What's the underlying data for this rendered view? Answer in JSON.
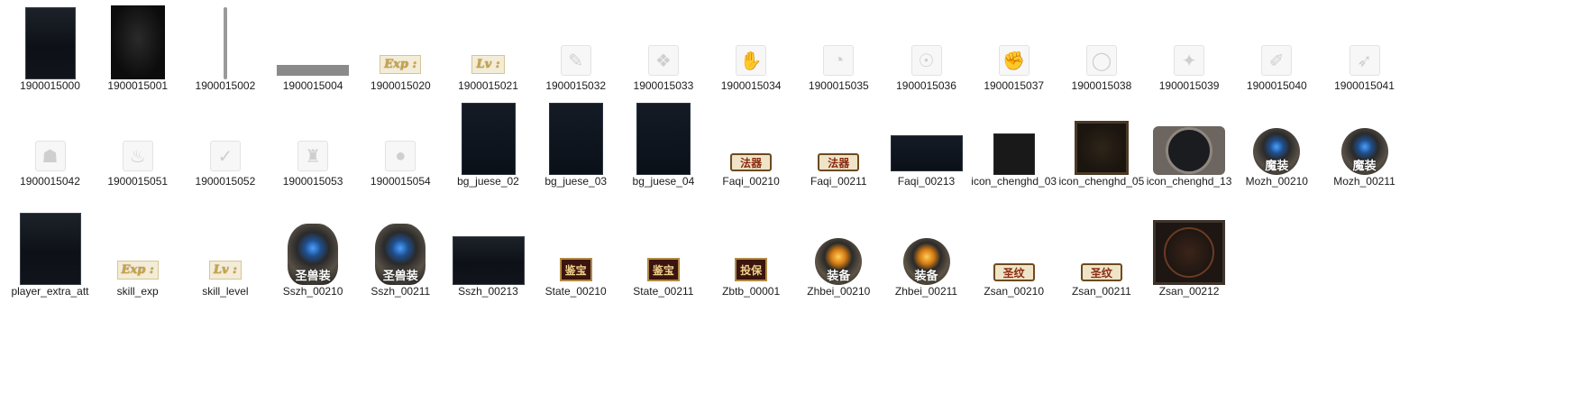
{
  "files": [
    {
      "name": "1900015000",
      "thumb": "dark-panel-frame"
    },
    {
      "name": "1900015001",
      "thumb": "black-panel"
    },
    {
      "name": "1900015002",
      "thumb": "vertical-bar"
    },
    {
      "name": "1900015004",
      "thumb": "horizontal-bar"
    },
    {
      "name": "1900015020",
      "thumb": "exp-label",
      "thumb_text": "Exp :"
    },
    {
      "name": "1900015021",
      "thumb": "lv-label",
      "thumb_text": "Lv :"
    },
    {
      "name": "1900015032",
      "thumb": "ghost-icon",
      "glyph": "✎"
    },
    {
      "name": "1900015033",
      "thumb": "ghost-icon",
      "glyph": "❖"
    },
    {
      "name": "1900015034",
      "thumb": "ghost-icon",
      "glyph": "✋"
    },
    {
      "name": "1900015035",
      "thumb": "ghost-icon",
      "glyph": "◔"
    },
    {
      "name": "1900015036",
      "thumb": "ghost-icon",
      "glyph": "☉"
    },
    {
      "name": "1900015037",
      "thumb": "ghost-icon",
      "glyph": "✊"
    },
    {
      "name": "1900015038",
      "thumb": "ghost-icon",
      "glyph": "◯"
    },
    {
      "name": "1900015039",
      "thumb": "ghost-icon",
      "glyph": "✦"
    },
    {
      "name": "1900015040",
      "thumb": "ghost-icon",
      "glyph": "✐"
    },
    {
      "name": "1900015041",
      "thumb": "ghost-icon",
      "glyph": "➶"
    },
    {
      "name": "1900015042",
      "thumb": "ghost-icon",
      "glyph": "☗"
    },
    {
      "name": "1900015051",
      "thumb": "ghost-icon",
      "glyph": "♨"
    },
    {
      "name": "1900015052",
      "thumb": "ghost-icon",
      "glyph": "✓"
    },
    {
      "name": "1900015053",
      "thumb": "ghost-icon",
      "glyph": "♜"
    },
    {
      "name": "1900015054",
      "thumb": "ghost-icon",
      "glyph": "●"
    },
    {
      "name": "bg_juese_02",
      "thumb": "navy-panel"
    },
    {
      "name": "bg_juese_03",
      "thumb": "navy-panel"
    },
    {
      "name": "bg_juese_04",
      "thumb": "navy-panel-slots"
    },
    {
      "name": "Faqi_00210",
      "thumb": "cream-badge",
      "thumb_text": "法器"
    },
    {
      "name": "Faqi_00211",
      "thumb": "cream-badge",
      "thumb_text": "法器"
    },
    {
      "name": "Faqi_00213",
      "thumb": "navy-wide-panel"
    },
    {
      "name": "icon_chenghd_03",
      "thumb": "slot-square"
    },
    {
      "name": "icon_chenghd_05",
      "thumb": "brown-frame"
    },
    {
      "name": "icon_chenghd_13",
      "thumb": "ring-frame"
    },
    {
      "name": "Mozh_00210",
      "thumb": "emblem-blue",
      "thumb_text": "魔装"
    },
    {
      "name": "Mozh_00211",
      "thumb": "emblem-blue",
      "thumb_text": "魔装"
    },
    {
      "name": "player_extra_att",
      "thumb": "dark-panel-tall"
    },
    {
      "name": "skill_exp",
      "thumb": "exp-label",
      "thumb_text": "Exp :"
    },
    {
      "name": "skill_level",
      "thumb": "lv-label",
      "thumb_text": "Lv :"
    },
    {
      "name": "Sszh_00210",
      "thumb": "emblem-blue-big",
      "thumb_text": "圣兽装"
    },
    {
      "name": "Sszh_00211",
      "thumb": "emblem-blue-big",
      "thumb_text": "圣兽装"
    },
    {
      "name": "Sszh_00213",
      "thumb": "dark-panel-wide"
    },
    {
      "name": "State_00210",
      "thumb": "red-badge",
      "thumb_text": "鉴宝"
    },
    {
      "name": "State_00211",
      "thumb": "red-badge",
      "thumb_text": "鉴宝"
    },
    {
      "name": "Zbtb_00001",
      "thumb": "red-badge",
      "thumb_text": "投保"
    },
    {
      "name": "Zhbei_00210",
      "thumb": "emblem-gold",
      "thumb_text": "装备"
    },
    {
      "name": "Zhbei_00211",
      "thumb": "emblem-gold",
      "thumb_text": "装备"
    },
    {
      "name": "Zsan_00210",
      "thumb": "cream-badge",
      "thumb_text": "圣纹"
    },
    {
      "name": "Zsan_00211",
      "thumb": "cream-badge",
      "thumb_text": "圣纹"
    },
    {
      "name": "Zsan_00212",
      "thumb": "pentagram-panel"
    }
  ]
}
